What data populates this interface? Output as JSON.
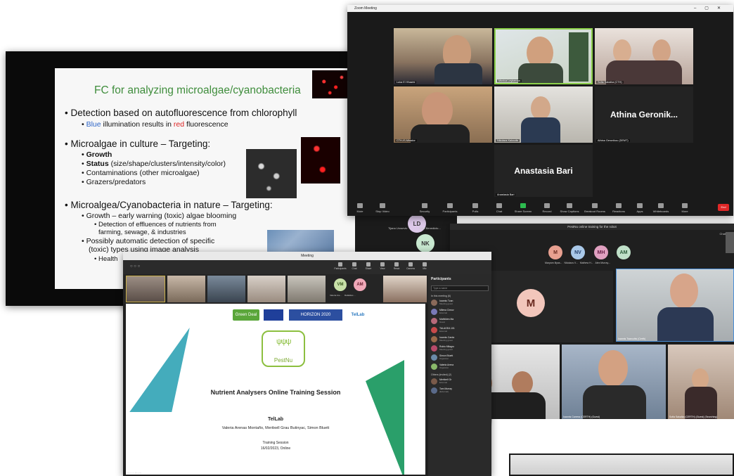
{
  "slide_window": {
    "slide": {
      "title": "FC for analyzing microalgae/cyanobacteria",
      "b1": "Detection based on autofluorescence from chlorophyll",
      "b1_sub_blue": "Blue",
      "b1_sub_mid": "illumination results in",
      "b1_sub_red": "red",
      "b1_sub_end": "fluorescence",
      "b2": "Microalgae in culture – Targeting:",
      "b2_items": [
        "Growth",
        "Status",
        "Contaminations (other microalgae)",
        "Grazers/predators"
      ],
      "b2_status_detail": "(size/shape/clusters/intensity/color)",
      "b3": "Microalgea/Cyanobacteria in nature – Targeting:",
      "b3_sub1": "Growth – early warning (toxic) algae blooming",
      "b3_sub1a": "Detection of effluences of nutrients from",
      "b3_sub1b": "farming, sewage, & industries",
      "b3_sub2": "Possibly automatic detection of specific",
      "b3_sub2b": "(toxic) types using image analysis",
      "b3_sub2c": "Health"
    }
  },
  "zoom_window": {
    "title": "Zoom Meeting",
    "tiles": [
      {
        "name": "Luka El Hhazini"
      },
      {
        "name": "Monica Leykeman"
      },
      {
        "name": "Sofia Sakalka (CTH)"
      },
      {
        "name": "CTH-IS-Mirador"
      },
      {
        "name": "Nikolaos Kaloudis"
      },
      {
        "name": "Athina Geronikou (DEMT)"
      },
      {
        "name": "Anastasia Bari"
      }
    ],
    "big_name_1": "Athina Geronik...",
    "big_name_2": "Anastasia Bari",
    "toolbar": [
      "Mute",
      "Stop Video",
      "Security",
      "Participants",
      "Polls",
      "Chat",
      "Share Screen",
      "Record",
      "Show Captions",
      "Breakout Rooms",
      "Reactions",
      "Apps",
      "Whiteboards",
      "More"
    ],
    "end_label": "End"
  },
  "avatars_mid": [
    {
      "initials": "LD"
    },
    {
      "initials": "NK"
    }
  ],
  "avatars_mid_names": [
    "Tijana Urosevic",
    "Lidia Benedicto..."
  ],
  "grid_window": {
    "title": "PestNu online training for the robot",
    "avatars": [
      {
        "initials": "M",
        "name": "Maryam Iliyas...",
        "color": "#e8a090"
      },
      {
        "initials": "NV",
        "name": "Nikolaos V...",
        "color": "#a9c8e8"
      },
      {
        "initials": "MH",
        "name": "Mathew H...",
        "color": "#e0a0c0"
      },
      {
        "initials": "AM",
        "name": "Alex Murray...",
        "color": "#bfe0c8"
      }
    ],
    "main_initial": "M",
    "tiles": [
      "Maryam Iliyas (Guest)",
      "Ioannis Tsarouhis (Certh)",
      "Michalis Lagakhais (External)",
      "Ioannis Carrera (CERTH) (Guest)",
      "Sofia Sakalka (CERTH) (Guest) (Searching)"
    ],
    "top_labels": [
      "Chat",
      "People"
    ]
  },
  "teams_window": {
    "title": "Meeting",
    "tools": [
      "Participants",
      "Chat",
      "Share",
      "View",
      "React",
      "Camera",
      "Mic"
    ],
    "strip_avatars": [
      {
        "initials": "VM",
        "name": "Valeria Are...",
        "color": "#c8e0a8"
      },
      {
        "initials": "AM",
        "name": "Rafalides ...",
        "color": "#f0a8b8"
      }
    ],
    "pane": {
      "title": "Participants",
      "search_placeholder": "Type a name",
      "section_in_meeting": "In this meeting (6)",
      "section_others": "Others (invited) (2)",
      "people": [
        {
          "name": "Ioannis Tzan",
          "status": "Meeting guest"
        },
        {
          "name": "Milena Cimov",
          "status": "External"
        },
        {
          "name": "Mathildes Ma",
          "status": "Guest"
        },
        {
          "name": "TALAGEA 101",
          "status": "External"
        },
        {
          "name": "Ioannis Carda",
          "status": "Meeting guest"
        },
        {
          "name": "Rubio Milagro",
          "status": "Meeting guest"
        },
        {
          "name": "Simon Bluett",
          "status": "Organizer"
        },
        {
          "name": "Valeria Arena",
          "status": "Organizer"
        }
      ],
      "others": [
        {
          "name": "Meritxell Gr",
          "status": "External"
        },
        {
          "name": "Tom Murray",
          "status": "(External)"
        }
      ]
    },
    "slide": {
      "logos": [
        "Green Deal",
        "HORIZON 2020",
        "TelLab"
      ],
      "brand": "PestNu",
      "heading": "Nutrient Analysers Online Training Session",
      "org": "TelLab",
      "authors": "Valeria Arenas Montaño, Meritxell Grau Butinyac, Simon Bluett",
      "session": "Training Session",
      "date": "16/02/2023, Online"
    },
    "bottom_name": "Simon Bluett"
  }
}
